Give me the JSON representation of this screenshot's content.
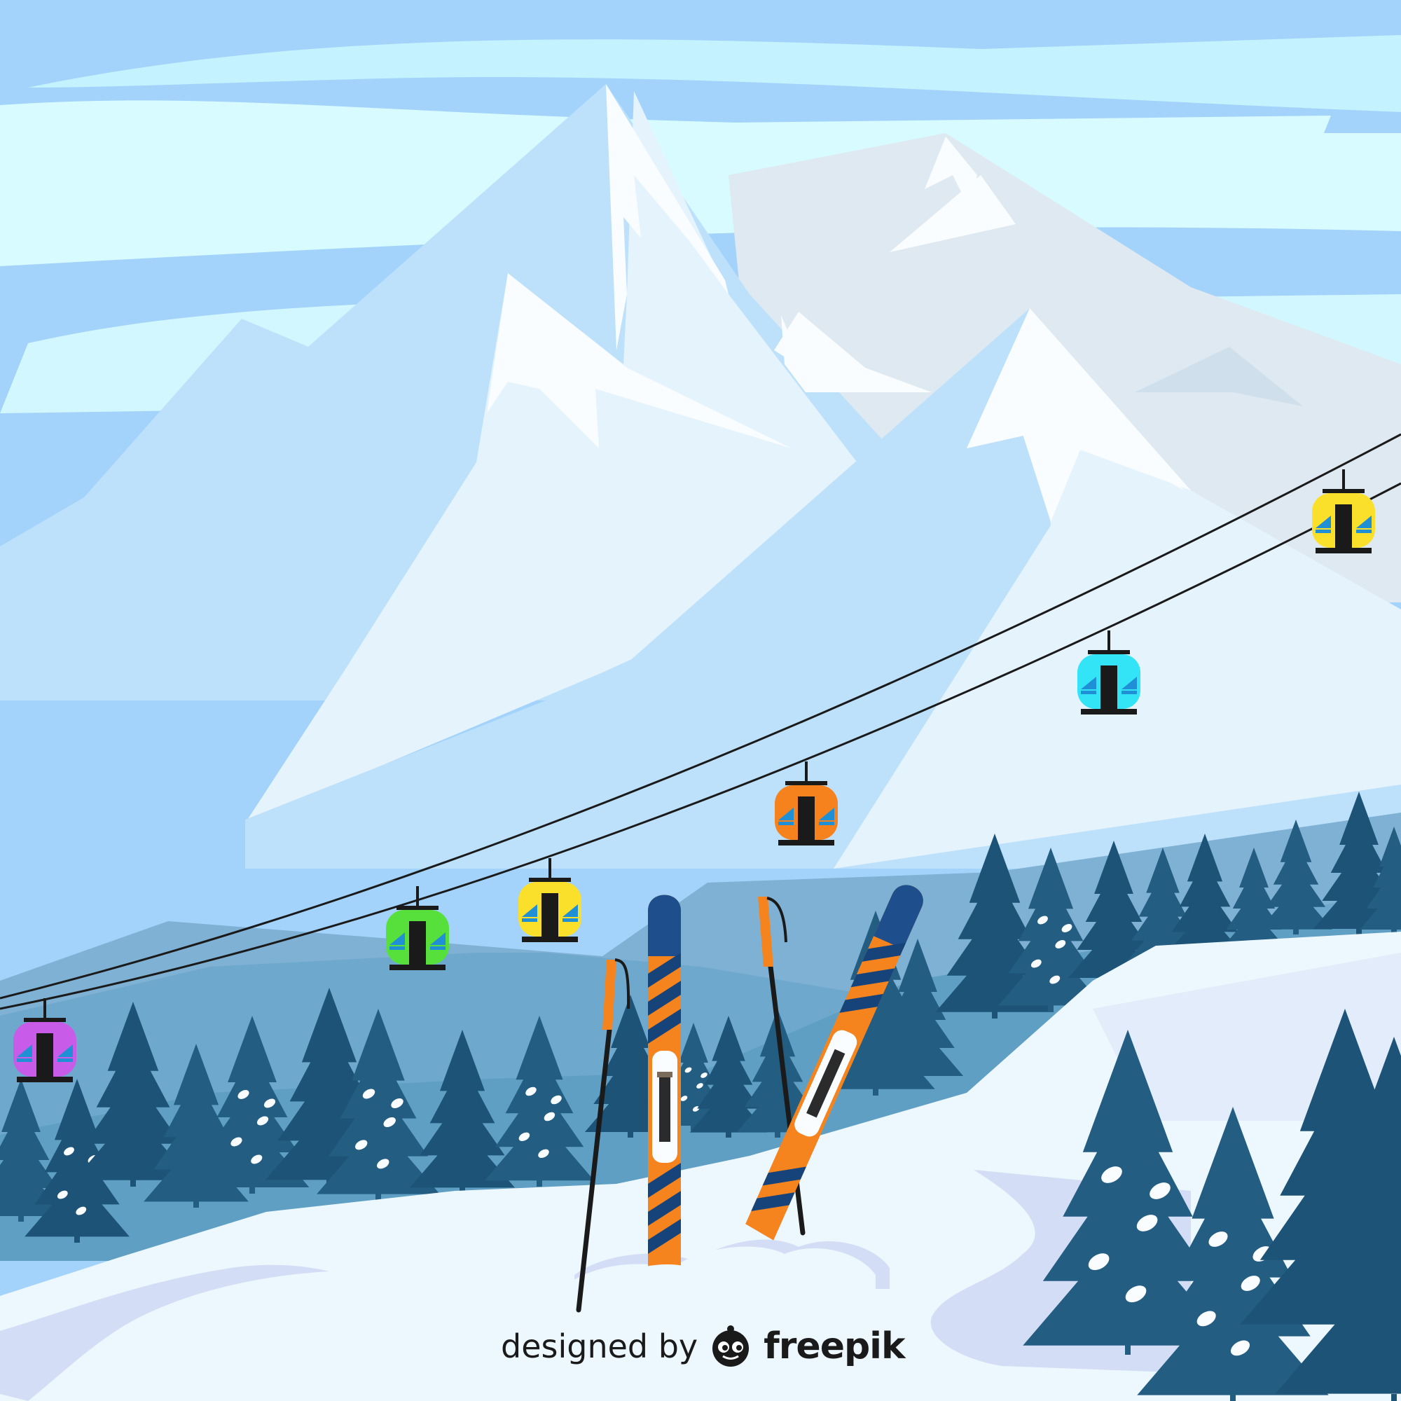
{
  "scene": {
    "title": "",
    "colors": {
      "sky": "#a3d3fb",
      "sky_light": "#d8fbff",
      "mountain": "#bde1fb",
      "mountain_light": "#e5f3fd",
      "snow": "#fafdff",
      "far_hills": "#7fb1d4",
      "mid_hills": "#5f9fc3",
      "ground_snow": "#edf7fe",
      "tree_dark": "#1c5377",
      "tree_mid": "#245d82",
      "cable": "#1a1a1a",
      "ski": "#f5841f",
      "ski_stripe": "#16447a",
      "ski_tip": "#1e4e8b",
      "pole": "#1a1a1a",
      "pole_grip": "#f5841f"
    },
    "gondolas": [
      {
        "name": "gondola-purple",
        "color": "#c85ce8"
      },
      {
        "name": "gondola-green",
        "color": "#57e03c"
      },
      {
        "name": "gondola-yellow-low",
        "color": "#fbe02b"
      },
      {
        "name": "gondola-orange",
        "color": "#f6821e"
      },
      {
        "name": "gondola-cyan",
        "color": "#33e4f6"
      },
      {
        "name": "gondola-yellow-high",
        "color": "#fbe02b"
      }
    ],
    "icons": {
      "logo": "freepik-logo-icon"
    }
  },
  "credit": {
    "prefix": "designed by",
    "brand": "freepik"
  }
}
